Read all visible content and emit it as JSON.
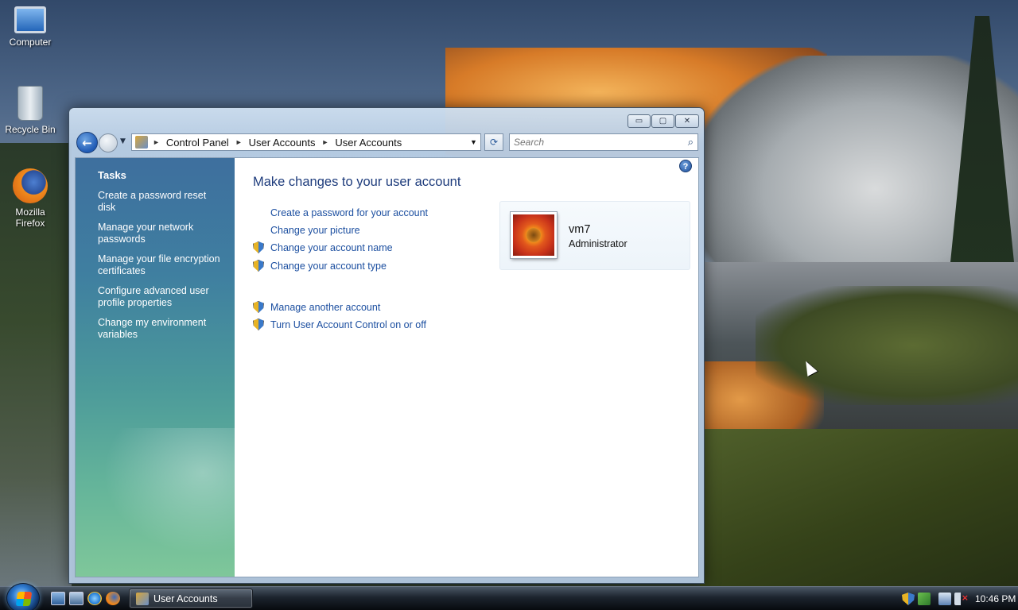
{
  "desktop": {
    "icons": [
      {
        "label": "Computer",
        "icon": "computer-icon"
      },
      {
        "label": "Recycle Bin",
        "icon": "recycle-bin-icon"
      },
      {
        "label": "Mozilla Firefox",
        "icon": "firefox-icon"
      }
    ]
  },
  "window": {
    "caption_buttons": {
      "minimize": "▭",
      "maximize": "▢",
      "close": "✕"
    },
    "nav": {
      "back_glyph": "←",
      "dropdown_glyph": "▼"
    },
    "address": {
      "crumbs": [
        "Control Panel",
        "User Accounts",
        "User Accounts"
      ],
      "separator": "►",
      "dropdown_glyph": "▼",
      "refresh_glyph": "⟳"
    },
    "search": {
      "placeholder": "Search",
      "icon": "⌕"
    },
    "help_glyph": "?",
    "tasks": {
      "title": "Tasks",
      "links": [
        "Create a password reset disk",
        "Manage your network passwords",
        "Manage your file encryption certificates",
        "Configure advanced user profile properties",
        "Change my environment variables"
      ]
    },
    "main": {
      "title": "Make changes to your user account",
      "links": [
        {
          "label": "Create a password for your account",
          "shield": false
        },
        {
          "label": "Change your picture",
          "shield": false
        },
        {
          "label": "Change your account name",
          "shield": true
        },
        {
          "label": "Change your account type",
          "shield": true
        },
        {
          "label": "Manage another account",
          "shield": true
        },
        {
          "label": "Turn User Account Control on or off",
          "shield": true
        }
      ],
      "user": {
        "name": "vm7",
        "role": "Administrator"
      }
    }
  },
  "taskbar": {
    "active_task": "User Accounts",
    "clock": "10:46 PM"
  },
  "colors": {
    "link": "#1c4fa0",
    "title": "#1e3c7c",
    "tasks_panel_top": "#3e6f9e",
    "tasks_panel_bottom": "#7fc79a"
  }
}
